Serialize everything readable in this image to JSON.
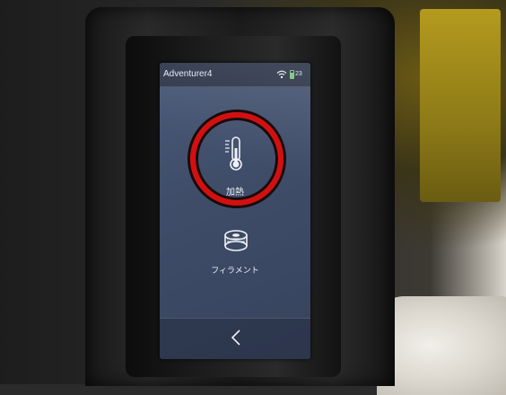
{
  "status_bar": {
    "title": "Adventurer4",
    "wifi_icon": "wifi-icon",
    "battery_icon": "battery-icon",
    "readout": "23"
  },
  "menu": {
    "heat": {
      "label": "加熱",
      "icon": "thermometer-icon"
    },
    "filament": {
      "label": "フィラメント",
      "icon": "spool-icon"
    }
  },
  "nav": {
    "back_icon": "chevron-left-icon"
  },
  "colors": {
    "highlight_ring": "#d40f0f",
    "screen_bg": "#3f4d69",
    "battery": "#7ec47a"
  }
}
